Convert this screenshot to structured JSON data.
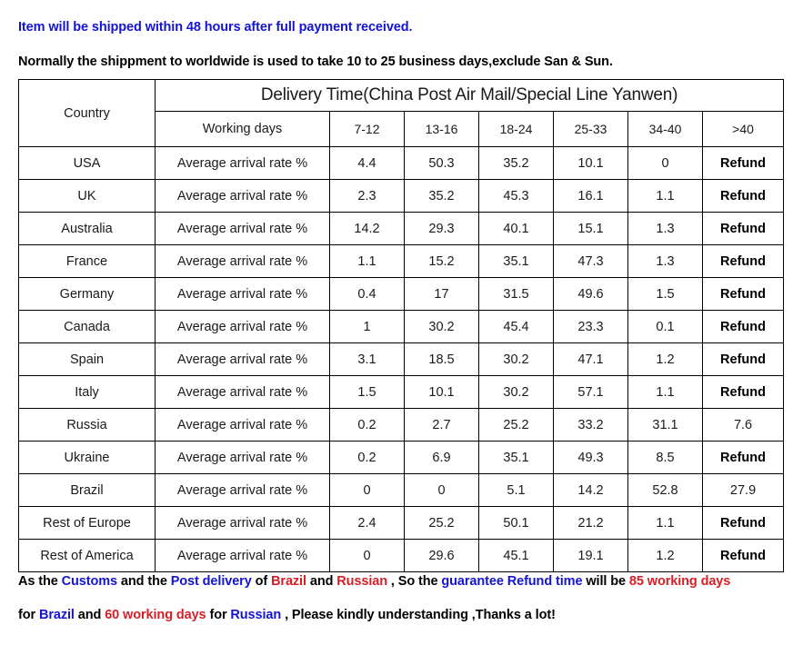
{
  "notices": {
    "shipping": "Item will be shipped within 48 hours after full payment received.",
    "worldwide": "Normally the shippment to worldwide is used to take 10 to 25 business days,exclude San & Sun."
  },
  "colors": {
    "blue": "#1414d2",
    "red": "#d81f26",
    "black": "#000000",
    "border": "#000000"
  },
  "table": {
    "country_header": "Country",
    "delivery_header": "Delivery Time(China Post Air Mail/Special Line Yanwen)",
    "working_days_header": "Working days",
    "day_ranges": [
      "7-12",
      "13-16",
      "18-24",
      "25-33",
      "34-40",
      ">40"
    ],
    "metric_label": "Average arrival rate %",
    "refund_label": "Refund",
    "rows": [
      {
        "country": "USA",
        "values": [
          "4.4",
          "50.3",
          "35.2",
          "10.1",
          "0",
          "Refund"
        ]
      },
      {
        "country": "UK",
        "values": [
          "2.3",
          "35.2",
          "45.3",
          "16.1",
          "1.1",
          "Refund"
        ]
      },
      {
        "country": "Australia",
        "values": [
          "14.2",
          "29.3",
          "40.1",
          "15.1",
          "1.3",
          "Refund"
        ]
      },
      {
        "country": "France",
        "values": [
          "1.1",
          "15.2",
          "35.1",
          "47.3",
          "1.3",
          "Refund"
        ]
      },
      {
        "country": "Germany",
        "values": [
          "0.4",
          "17",
          "31.5",
          "49.6",
          "1.5",
          "Refund"
        ]
      },
      {
        "country": "Canada",
        "values": [
          "1",
          "30.2",
          "45.4",
          "23.3",
          "0.1",
          "Refund"
        ]
      },
      {
        "country": "Spain",
        "values": [
          "3.1",
          "18.5",
          "30.2",
          "47.1",
          "1.2",
          "Refund"
        ]
      },
      {
        "country": "Italy",
        "values": [
          "1.5",
          "10.1",
          "30.2",
          "57.1",
          "1.1",
          "Refund"
        ]
      },
      {
        "country": "Russia",
        "values": [
          "0.2",
          "2.7",
          "25.2",
          "33.2",
          "31.1",
          "7.6"
        ]
      },
      {
        "country": "Ukraine",
        "values": [
          "0.2",
          "6.9",
          "35.1",
          "49.3",
          "8.5",
          "Refund"
        ]
      },
      {
        "country": "Brazil",
        "values": [
          "0",
          "0",
          "5.1",
          "14.2",
          "52.8",
          "27.9"
        ]
      },
      {
        "country": "Rest of Europe",
        "values": [
          "2.4",
          "25.2",
          "50.1",
          "21.2",
          "1.1",
          "Refund"
        ]
      },
      {
        "country": "Rest of America",
        "values": [
          "0",
          "29.6",
          "45.1",
          "19.1",
          "1.2",
          "Refund"
        ]
      }
    ]
  },
  "chart_data": {
    "type": "table",
    "title": "Delivery Time(China Post Air Mail/Special Line Yanwen)",
    "xlabel": "Working days",
    "ylabel": "Country",
    "categories": [
      "7-12",
      "13-16",
      "18-24",
      "25-33",
      "34-40",
      ">40"
    ],
    "series": [
      {
        "name": "USA",
        "values": [
          4.4,
          50.3,
          35.2,
          10.1,
          0,
          null
        ]
      },
      {
        "name": "UK",
        "values": [
          2.3,
          35.2,
          45.3,
          16.1,
          1.1,
          null
        ]
      },
      {
        "name": "Australia",
        "values": [
          14.2,
          29.3,
          40.1,
          15.1,
          1.3,
          null
        ]
      },
      {
        "name": "France",
        "values": [
          1.1,
          15.2,
          35.1,
          47.3,
          1.3,
          null
        ]
      },
      {
        "name": "Germany",
        "values": [
          0.4,
          17,
          31.5,
          49.6,
          1.5,
          null
        ]
      },
      {
        "name": "Canada",
        "values": [
          1,
          30.2,
          45.4,
          23.3,
          0.1,
          null
        ]
      },
      {
        "name": "Spain",
        "values": [
          3.1,
          18.5,
          30.2,
          47.1,
          1.2,
          null
        ]
      },
      {
        "name": "Italy",
        "values": [
          1.5,
          10.1,
          30.2,
          57.1,
          1.1,
          null
        ]
      },
      {
        "name": "Russia",
        "values": [
          0.2,
          2.7,
          25.2,
          33.2,
          31.1,
          7.6
        ]
      },
      {
        "name": "Ukraine",
        "values": [
          0.2,
          6.9,
          35.1,
          49.3,
          8.5,
          null
        ]
      },
      {
        "name": "Brazil",
        "values": [
          0,
          0,
          5.1,
          14.2,
          52.8,
          27.9
        ]
      },
      {
        "name": "Rest of Europe",
        "values": [
          2.4,
          25.2,
          50.1,
          21.2,
          1.1,
          null
        ]
      },
      {
        "name": "Rest of America",
        "values": [
          0,
          29.6,
          45.1,
          19.1,
          1.2,
          null
        ]
      }
    ],
    "null_meaning": "Refund"
  },
  "footer": {
    "line1": [
      {
        "text": "As the ",
        "color": "black"
      },
      {
        "text": "Customs",
        "color": "blue"
      },
      {
        "text": " and the ",
        "color": "black"
      },
      {
        "text": "Post delivery",
        "color": "blue"
      },
      {
        "text": " of ",
        "color": "black"
      },
      {
        "text": "Brazil",
        "color": "red"
      },
      {
        "text": " and ",
        "color": "black"
      },
      {
        "text": "Russian",
        "color": "red"
      },
      {
        "text": " , So the ",
        "color": "black"
      },
      {
        "text": "guarantee Refund time",
        "color": "blue"
      },
      {
        "text": " will be ",
        "color": "black"
      },
      {
        "text": "85 working days",
        "color": "red"
      }
    ],
    "line2": [
      {
        "text": "for ",
        "color": "black"
      },
      {
        "text": "Brazil",
        "color": "blue"
      },
      {
        "text": " and ",
        "color": "black"
      },
      {
        "text": "60 working days",
        "color": "red"
      },
      {
        "text": " for ",
        "color": "black"
      },
      {
        "text": "Russian",
        "color": "blue"
      },
      {
        "text": " , Please kindly understanding ,Thanks a lot!",
        "color": "black"
      }
    ]
  }
}
